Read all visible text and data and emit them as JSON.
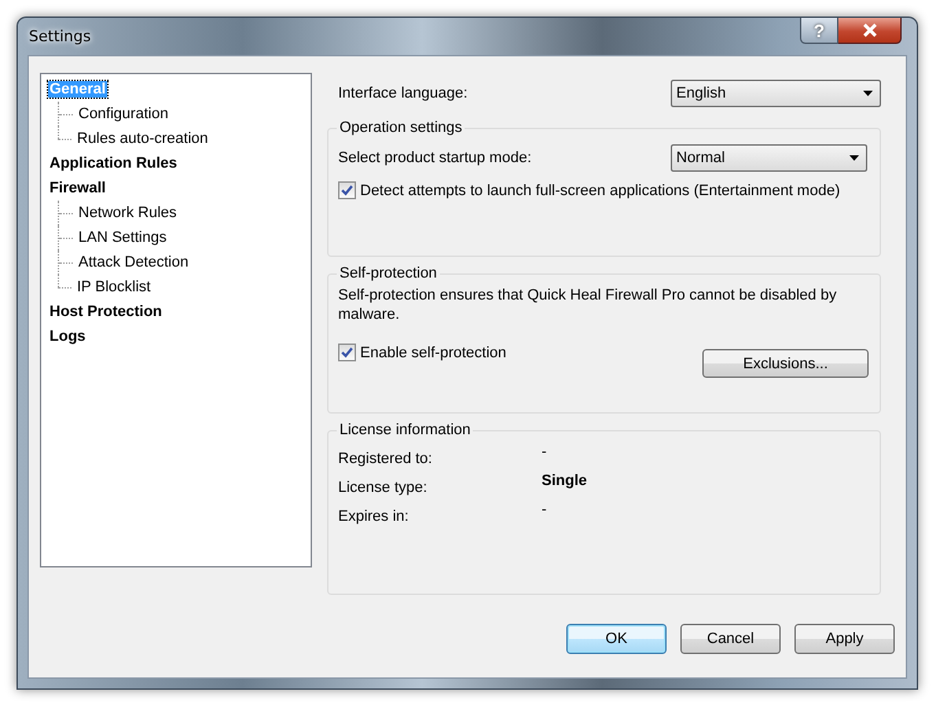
{
  "window": {
    "title": "Settings",
    "help_button": "?"
  },
  "sidebar": {
    "items": [
      {
        "label": "General",
        "selected": true,
        "children": [
          {
            "label": "Configuration",
            "selected": false
          },
          {
            "label": "Rules auto-creation",
            "selected": false
          }
        ]
      },
      {
        "label": "Application Rules",
        "selected": false
      },
      {
        "label": "Firewall",
        "selected": false,
        "children": [
          {
            "label": "Network Rules",
            "selected": false
          },
          {
            "label": "LAN Settings",
            "selected": false
          },
          {
            "label": "Attack Detection",
            "selected": false
          },
          {
            "label": "IP Blocklist",
            "selected": false
          }
        ]
      },
      {
        "label": "Host Protection",
        "selected": false
      },
      {
        "label": "Logs",
        "selected": false
      }
    ]
  },
  "interface_language": {
    "label": "Interface language:",
    "value": "English"
  },
  "operation_settings": {
    "title": "Operation settings",
    "startup_mode": {
      "label": "Select product startup mode:",
      "value": "Normal"
    },
    "entertainment_mode": {
      "label": "Detect attempts to launch full-screen applications (Entertainment mode)",
      "checked": true
    }
  },
  "self_protection": {
    "title": "Self-protection",
    "description": "Self-protection ensures that Quick Heal Firewall Pro cannot be disabled by malware.",
    "enable": {
      "label": "Enable self-protection",
      "checked": true
    },
    "exclusions_button": "Exclusions..."
  },
  "license_information": {
    "title": "License information",
    "rows": [
      {
        "label": "Registered to:",
        "value": "-",
        "bold": false
      },
      {
        "label": "License type:",
        "value": "Single",
        "bold": true
      },
      {
        "label": "Expires in:",
        "value": "-",
        "bold": false
      }
    ]
  },
  "buttons": [
    {
      "label": "OK",
      "default": true
    },
    {
      "label": "Cancel",
      "default": false
    },
    {
      "label": "Apply",
      "default": false
    }
  ]
}
